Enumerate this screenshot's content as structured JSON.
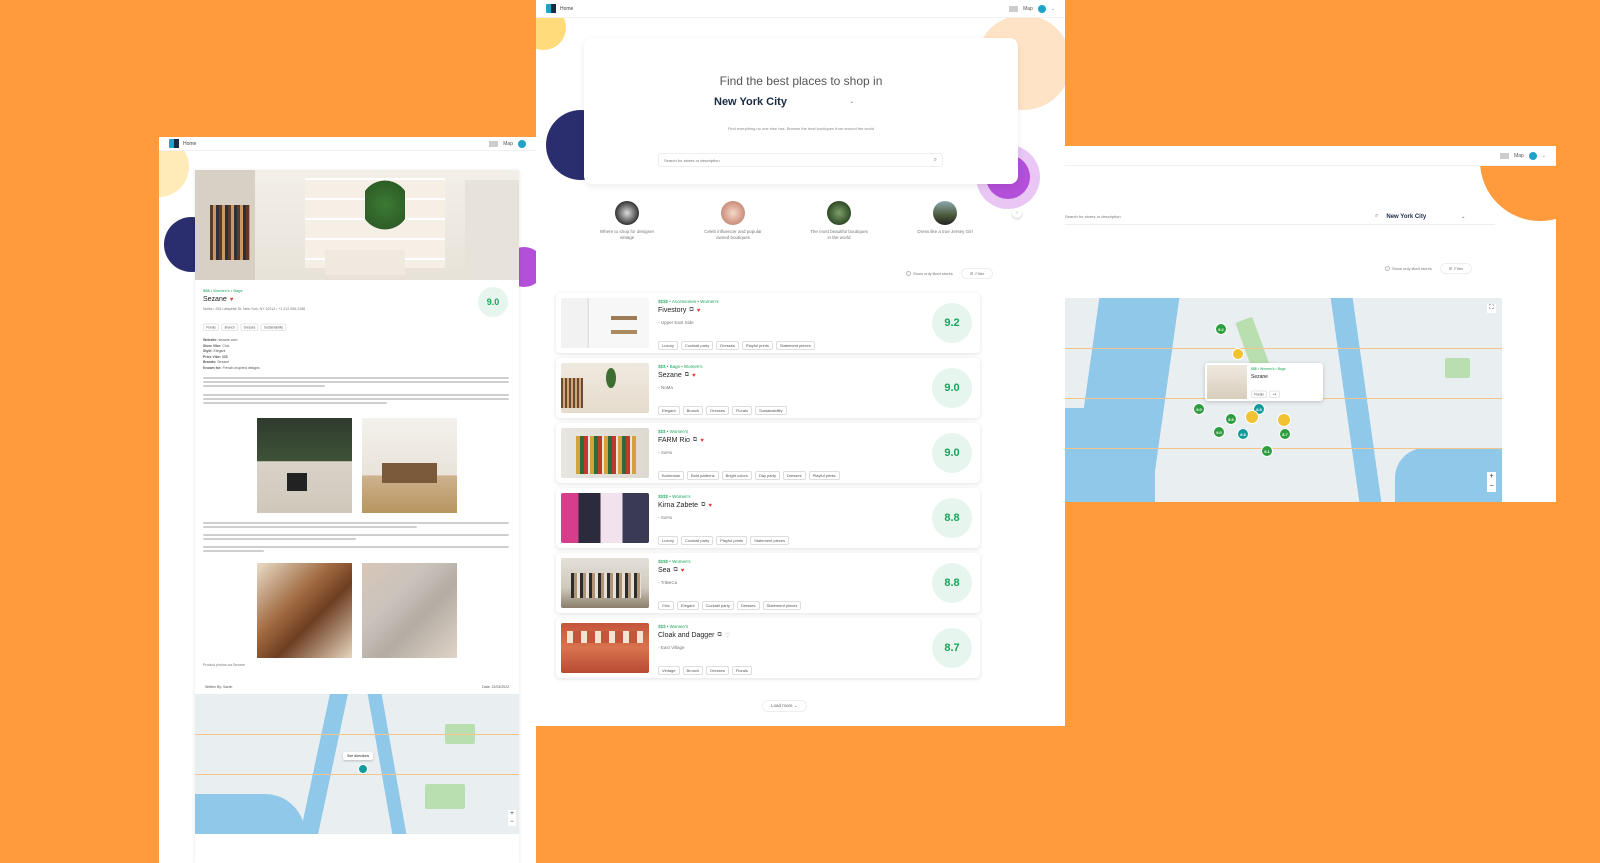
{
  "brand": {
    "name": "Home"
  },
  "nav": {
    "map": "Map"
  },
  "colors": {
    "background": "#FF9A3D",
    "accent": "#1aa55a",
    "teal": "#1fa3c9"
  },
  "hero": {
    "heading": "Find the best places to shop in",
    "city": "New York City",
    "subtext": "Find everything no one else has. Browse the best boutiques from around the world",
    "search_placeholder": "Search for stores or description"
  },
  "collections": [
    {
      "label": "Where to shop for designer vintage"
    },
    {
      "label": "Celeb influencer and popular owned boutiques"
    },
    {
      "label": "The most beautiful boutiques in the world"
    },
    {
      "label": "Dress like a true Jersey Girl"
    }
  ],
  "filters": {
    "only_liked": "Show only liked stores",
    "filter_button": "Filter"
  },
  "stores": [
    {
      "category": "$$$$ • Accessories • Women's",
      "name": "Fivestory",
      "location": "Upper East Side",
      "tags": [
        "Luxury",
        "Cocktail party",
        "Dresses",
        "Playful prints",
        "Statement pieces"
      ],
      "score": "9.2",
      "liked": true
    },
    {
      "category": "$$$ • Bags • Women's",
      "name": "Sezane",
      "location": "NoMa",
      "tags": [
        "Elegant",
        "Brunch",
        "Dresses",
        "Florals",
        "Sustainability"
      ],
      "score": "9.0",
      "liked": true
    },
    {
      "category": "$$$ • Women's",
      "name": "FARM Rio",
      "location": "SoHo",
      "tags": [
        "Bohemian",
        "Bold patterns",
        "Bright colors",
        "Day party",
        "Dresses",
        "Playful prints"
      ],
      "score": "9.0",
      "liked": true
    },
    {
      "category": "$$$$ • Women's",
      "name": "Kirna Zabete",
      "location": "SoHo",
      "tags": [
        "Luxury",
        "Cocktail party",
        "Playful prints",
        "Statement pieces"
      ],
      "score": "8.8",
      "liked": true
    },
    {
      "category": "$$$$ • Women's",
      "name": "Sea",
      "location": "TriBeCa",
      "tags": [
        "Chic",
        "Elegant",
        "Cocktail party",
        "Dresses",
        "Statement pieces"
      ],
      "score": "8.8",
      "liked": true
    },
    {
      "category": "$$$ • Women's",
      "name": "Cloak and Dagger",
      "location": "East Village",
      "tags": [
        "Vintage",
        "Brunch",
        "Dresses",
        "Florals"
      ],
      "score": "8.7",
      "liked": false
    }
  ],
  "load_more": "Load more",
  "detail": {
    "category": "$$$ • Women's • Bags",
    "name": "Sezane",
    "address": "NoMa • 254 Lafayette St, New York, NY 10012 • +1 212-555-0188",
    "score": "9.0",
    "tags": [
      "Florals",
      "Brunch",
      "Dresses",
      "Sustainability"
    ],
    "info": [
      {
        "k": "Website:",
        "v": "sezane.com"
      },
      {
        "k": "Store Vibe:",
        "v": "Chic"
      },
      {
        "k": "Style:",
        "v": "Elegant"
      },
      {
        "k": "Price Vibe:",
        "v": "$$$"
      },
      {
        "k": "Brands:",
        "v": "Sezane"
      },
      {
        "k": "Known for:",
        "v": "French-inspired designs"
      }
    ],
    "caption": "Product photos via Sezane",
    "written_by": "Written By: Sarah",
    "date": "Date: 12/03/2022",
    "map_popup": "See directions"
  },
  "map_view": {
    "search_placeholder": "Search for stores or description",
    "city": "New York City",
    "popup": {
      "category": "$$$ • Women's • Bags",
      "name": "Sezane",
      "tags": [
        "Florals",
        "+4"
      ]
    },
    "pins": [
      "9.2",
      "9.0",
      "9.0",
      "8.8",
      "8.8",
      "8.7",
      "9.1",
      "8.5"
    ]
  }
}
